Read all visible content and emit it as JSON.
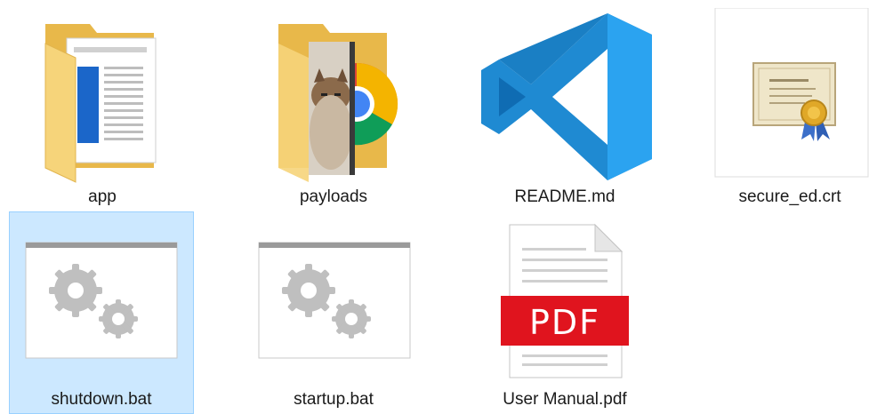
{
  "files": [
    {
      "name": "app",
      "icon": "folder-icon",
      "selected": false
    },
    {
      "name": "payloads",
      "icon": "folder-icon",
      "selected": false
    },
    {
      "name": "README.md",
      "icon": "vscode-icon",
      "selected": false
    },
    {
      "name": "secure_ed.crt",
      "icon": "certificate-icon",
      "selected": false
    },
    {
      "name": "shutdown.bat",
      "icon": "batch-file-icon",
      "selected": true
    },
    {
      "name": "startup.bat",
      "icon": "batch-file-icon",
      "selected": false
    },
    {
      "name": "User Manual.pdf",
      "icon": "pdf-icon",
      "selected": false
    }
  ],
  "pdf_badge": "PDF",
  "colors": {
    "selection_bg": "#cce8ff",
    "selection_border": "#99d1ff",
    "folder": "#f3cf6c",
    "vscode_blue": "#1f8ad2",
    "pdf_red": "#e0141e"
  }
}
